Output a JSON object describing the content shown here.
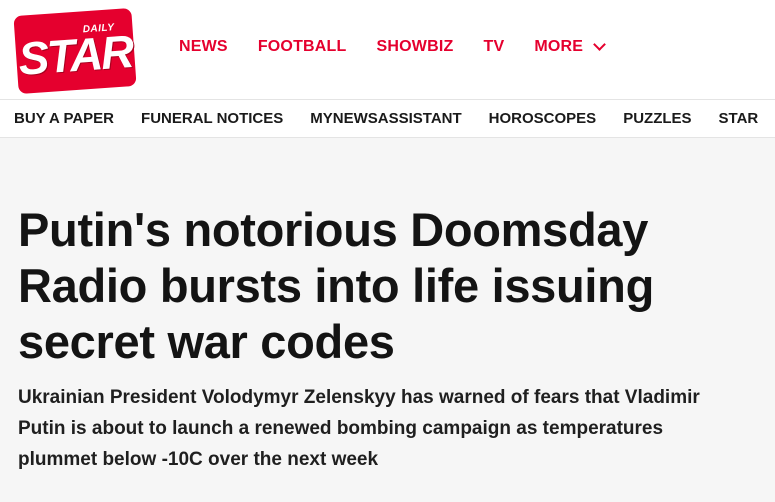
{
  "logo": {
    "small_text": "DAILY",
    "big_text": "STAR"
  },
  "main_nav": {
    "items": [
      "NEWS",
      "FOOTBALL",
      "SHOWBIZ",
      "TV"
    ],
    "more_label": "MORE",
    "more_icon": "chevron-down-icon"
  },
  "sub_nav": {
    "items": [
      "BUY A PAPER",
      "FUNERAL NOTICES",
      "MYNEWSASSISTANT",
      "HOROSCOPES",
      "PUZZLES",
      "STAR"
    ]
  },
  "article": {
    "headline": "Putin's notorious Doomsday Radio bursts into life issuing secret war codes",
    "standfirst": "Ukrainian President Volodymyr Zelenskyy has warned of fears that Vladimir Putin is about to launch a renewed bombing campaign as temperatures plummet below -10C over the next week"
  },
  "colors": {
    "brand_red": "#e5002e",
    "page_bg": "#f6f6f6",
    "text": "#1a1a1a"
  }
}
